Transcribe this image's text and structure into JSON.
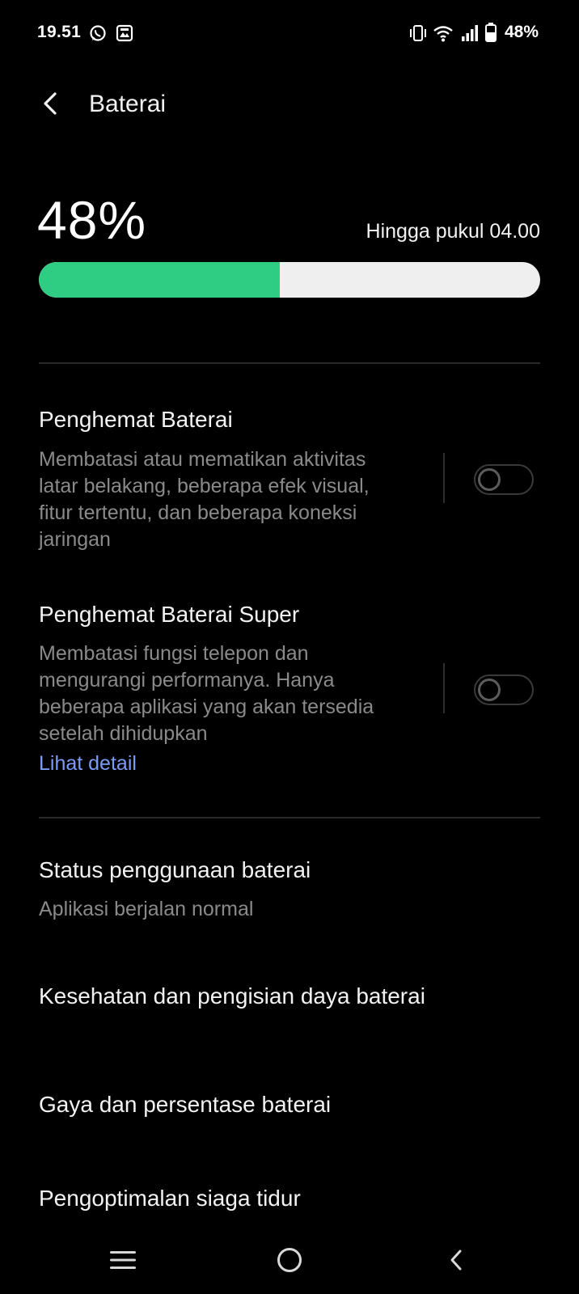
{
  "status_bar": {
    "time": "19.51",
    "battery_text": "48%",
    "icons": [
      "whatsapp-icon",
      "gallery-notification-icon",
      "vibrate-icon",
      "wifi-icon",
      "signal-icon",
      "battery-icon"
    ]
  },
  "header": {
    "title": "Baterai",
    "back_icon": "chevron-left-icon"
  },
  "battery": {
    "percent_text": "48%",
    "level": 0.48,
    "until_text": "Hingga pukul 04.00",
    "fill_color": "#2fcd84",
    "track_color": "#efefef"
  },
  "saver": {
    "title": "Penghemat Baterai",
    "description": "Membatasi atau mematikan aktivitas latar belakang, beberapa efek visual, fitur tertentu, dan beberapa koneksi jaringan",
    "enabled": false
  },
  "super_saver": {
    "title": "Penghemat Baterai Super",
    "description": "Membatasi fungsi telepon dan mengurangi performanya. Hanya beberapa aplikasi yang akan tersedia setelah dihidupkan",
    "link": "Lihat detail",
    "enabled": false
  },
  "usage_status": {
    "title": "Status penggunaan baterai",
    "subtitle": "Aplikasi berjalan normal"
  },
  "menu_items": [
    {
      "label": "Kesehatan dan pengisian daya baterai"
    },
    {
      "label": "Gaya dan persentase baterai"
    },
    {
      "label": "Pengoptimalan siaga tidur"
    }
  ],
  "nav_bar": {
    "icons": [
      "menu-icon",
      "home-icon",
      "back-icon"
    ]
  },
  "colors": {
    "background": "#000000",
    "accent_link": "#7b9bf5",
    "secondary_text": "#8a8a8a"
  }
}
